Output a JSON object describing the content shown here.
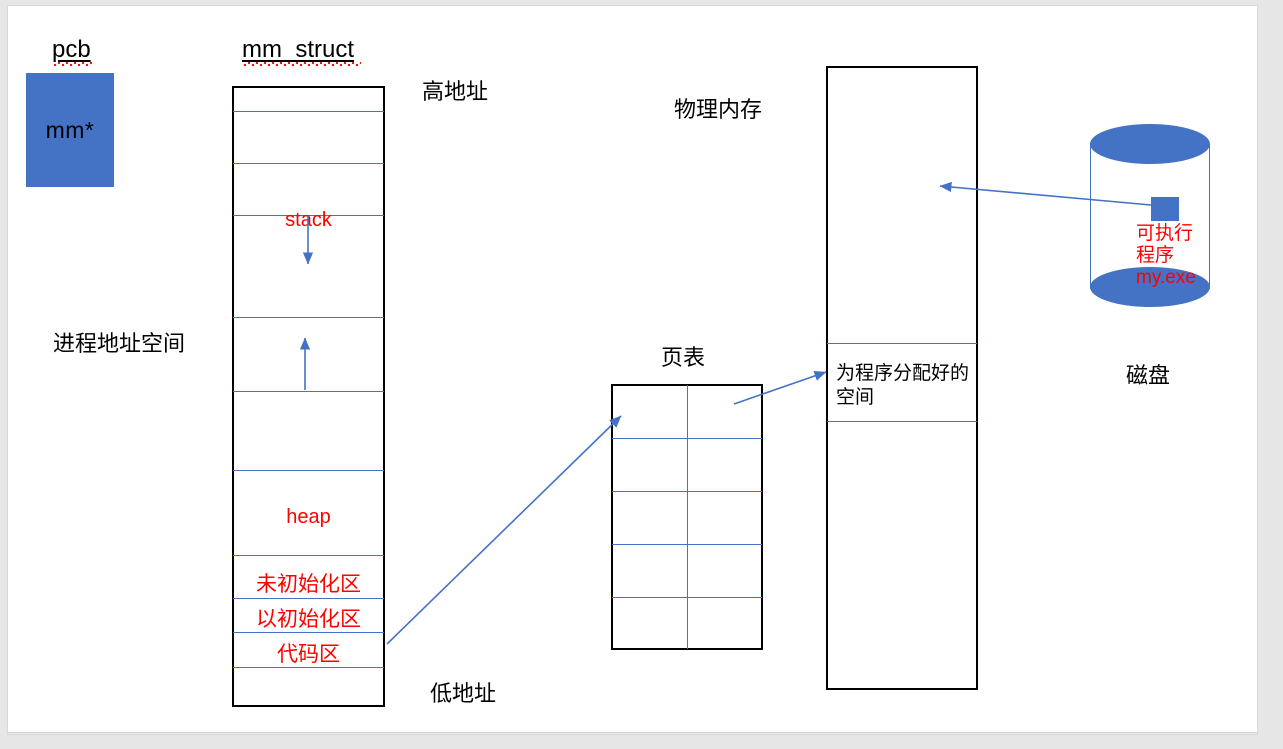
{
  "diagram": {
    "titles": {
      "pcb": "pcb",
      "mm_struct": "mm_struct"
    },
    "pcb_block_label": "mm*",
    "free_labels": {
      "high_address": "高地址",
      "low_address": "低地址",
      "process_address_space": "进程地址空间",
      "physical_memory": "物理内存",
      "page_table": "页表",
      "disk": "磁盘"
    },
    "mm_segments": [
      {
        "name": "kernel-top-gap",
        "label": ""
      },
      {
        "name": "stack",
        "label": "stack"
      },
      {
        "name": "stack-grow-gap",
        "label": ""
      },
      {
        "name": "mmap-gap",
        "label": ""
      },
      {
        "name": "heap",
        "label": "heap"
      },
      {
        "name": "bss",
        "label": "未初始化区"
      },
      {
        "name": "data",
        "label": "以初始化区"
      },
      {
        "name": "text",
        "label": "代码区"
      },
      {
        "name": "bottom-gap",
        "label": ""
      }
    ],
    "physical_memory": {
      "allocated_label": "为程序分配好的\n空间"
    },
    "page_table": {
      "rows": 5,
      "columns": 2,
      "cells": [
        [
          "",
          ""
        ],
        [
          "",
          ""
        ],
        [
          "",
          ""
        ],
        [
          "",
          ""
        ],
        [
          "",
          ""
        ]
      ]
    },
    "disk": {
      "program_label": "可执行\n程序\nmy.exe"
    },
    "colors": {
      "accent_blue": "#4472C4",
      "label_red": "#FF0000",
      "outline_black": "#000000",
      "page_background": "#FFFFFF"
    }
  }
}
